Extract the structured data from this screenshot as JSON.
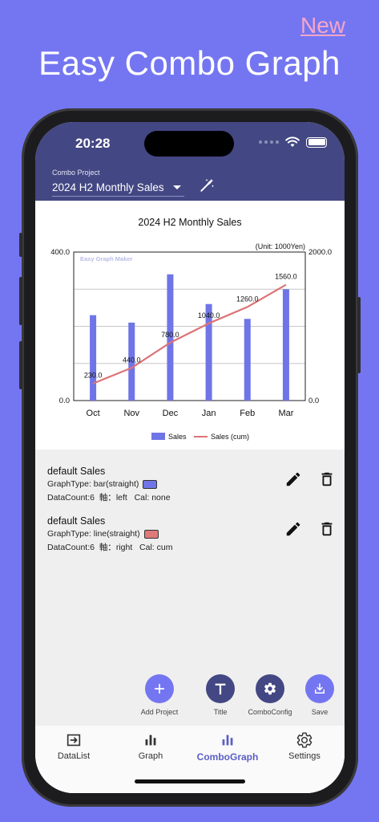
{
  "promo": {
    "new_label": "New",
    "title": "Easy Combo Graph"
  },
  "status": {
    "time": "20:28"
  },
  "header": {
    "project_label": "Combo Project",
    "project_value": "2024 H2 Monthly Sales"
  },
  "colors": {
    "appbar": "#434783",
    "bar": "#6f75e6",
    "line": "#dc7476",
    "accent": "#5a5fc4"
  },
  "chart_data": {
    "type": "bar+line",
    "title": "2024 H2 Monthly Sales",
    "unit_note": "(Unit: 1000Yen)",
    "watermark": "Easy Graph Maker",
    "categories": [
      "Oct",
      "Nov",
      "Dec",
      "Jan",
      "Feb",
      "Mar"
    ],
    "series": [
      {
        "name": "Sales",
        "type": "bar",
        "axis": "left",
        "values": [
          230,
          210,
          340,
          260,
          220,
          300
        ]
      },
      {
        "name": "Sales (cum)",
        "type": "line",
        "axis": "right",
        "values": [
          230,
          440,
          780,
          1040,
          1260,
          1560
        ],
        "labels": [
          "230.0",
          "440.0",
          "780.0",
          "1040.0",
          "1260.0",
          "1560.0"
        ]
      }
    ],
    "y_left": {
      "range": [
        0,
        400
      ],
      "labels": [
        "400.0",
        "0.0"
      ]
    },
    "y_right": {
      "range": [
        0,
        2000
      ],
      "labels": [
        "2000.0",
        "0.0"
      ]
    },
    "grid": true,
    "legend": "bottom"
  },
  "items": [
    {
      "title": "default Sales",
      "graph_type_label": "GraphType:",
      "graph_type": "bar(straight)",
      "swatch": "#6f75e6",
      "count_label": "DataCount:",
      "count": "6",
      "axis_label": "軸：",
      "axis": "left",
      "cal_label": "Cal:",
      "cal": "none"
    },
    {
      "title": "default Sales",
      "graph_type_label": "GraphType:",
      "graph_type": "line(straight)",
      "swatch": "#e07a7a",
      "count_label": "DataCount:",
      "count": "6",
      "axis_label": "軸：",
      "axis": "right",
      "cal_label": "Cal:",
      "cal": "cum"
    }
  ],
  "fabs": [
    {
      "label": "Add Project",
      "icon": "plus-icon"
    },
    {
      "label": "Title",
      "icon": "title-icon"
    },
    {
      "label": "ComboConfig",
      "icon": "gear-icon"
    },
    {
      "label": "Save",
      "icon": "download-icon"
    }
  ],
  "nav": [
    {
      "label": "DataList",
      "icon": "import-icon"
    },
    {
      "label": "Graph",
      "icon": "bar-chart-icon"
    },
    {
      "label": "ComboGraph",
      "icon": "bar-chart-icon",
      "active": true
    },
    {
      "label": "Settings",
      "icon": "gear-icon"
    }
  ]
}
